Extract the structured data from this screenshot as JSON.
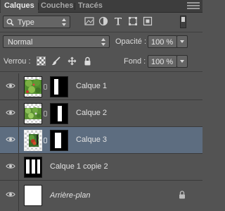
{
  "tabs": [
    {
      "label": "Calques"
    },
    {
      "label": "Couches"
    },
    {
      "label": "Tracés"
    }
  ],
  "filter": {
    "kind_value": "Type",
    "icons": [
      "image-filter-icon",
      "adjustment-filter-icon",
      "type-filter-icon",
      "shape-filter-icon",
      "smart-object-filter-icon"
    ]
  },
  "blend": {
    "mode_value": "Normal",
    "opacity_label": "Opacité :",
    "opacity_value": "100 %"
  },
  "lock": {
    "label": "Verrou :",
    "fill_label": "Fond :",
    "fill_value": "100 %"
  },
  "layers": [
    {
      "name": "Calque 1",
      "visible": true,
      "selected": false,
      "has_mask": true
    },
    {
      "name": "Calque 2",
      "visible": true,
      "selected": false,
      "has_mask": true
    },
    {
      "name": "Calque 3",
      "visible": true,
      "selected": true,
      "has_mask": true
    },
    {
      "name": "Calque 1 copie 2",
      "visible": true,
      "selected": false,
      "has_mask": false
    },
    {
      "name": "Arrière-plan",
      "visible": true,
      "selected": false,
      "has_mask": false,
      "locked": true
    }
  ],
  "colors": {
    "panel_bg": "#535353",
    "selected_row": "#5d6d80"
  }
}
